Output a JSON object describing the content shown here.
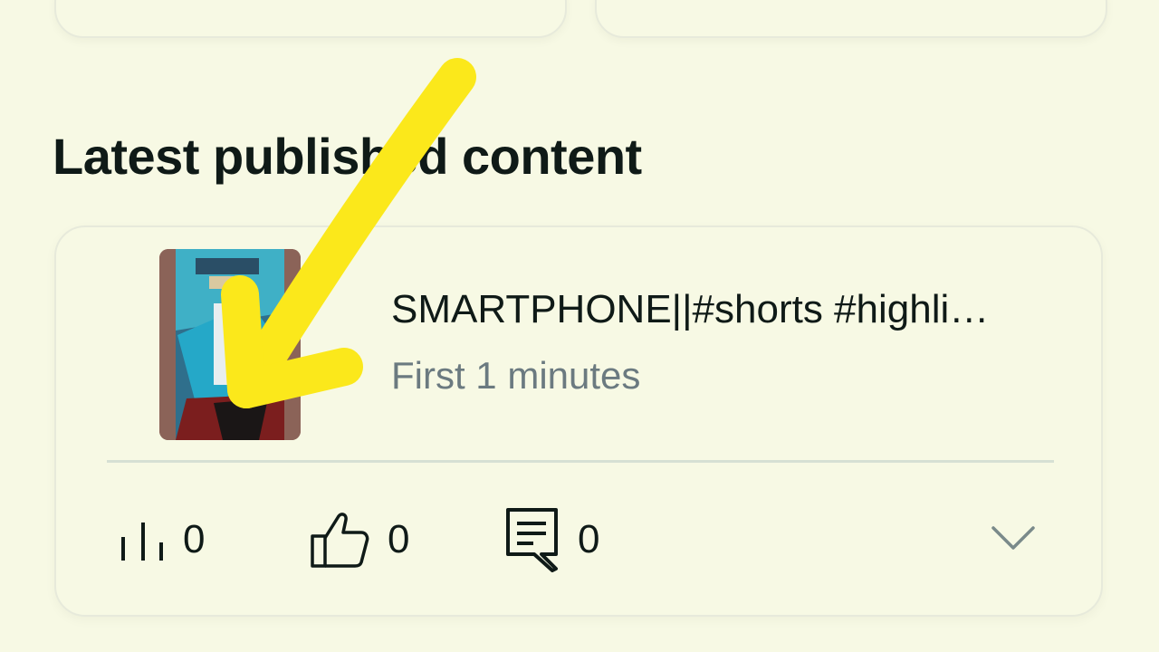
{
  "section": {
    "title": "Latest published content"
  },
  "content_item": {
    "title": "SMARTPHONE||#shorts #highli…",
    "subtitle": "First 1 minutes",
    "stats": {
      "views": "0",
      "likes": "0",
      "comments": "0"
    }
  },
  "icons": {
    "views": "bar-chart-icon",
    "likes": "thumbs-up-icon",
    "comments": "comment-icon",
    "expand": "chevron-down-icon"
  },
  "colors": {
    "background": "#f7f9e4",
    "annotation_arrow": "#fbe81b",
    "subtitle_text": "#6b7a80"
  }
}
